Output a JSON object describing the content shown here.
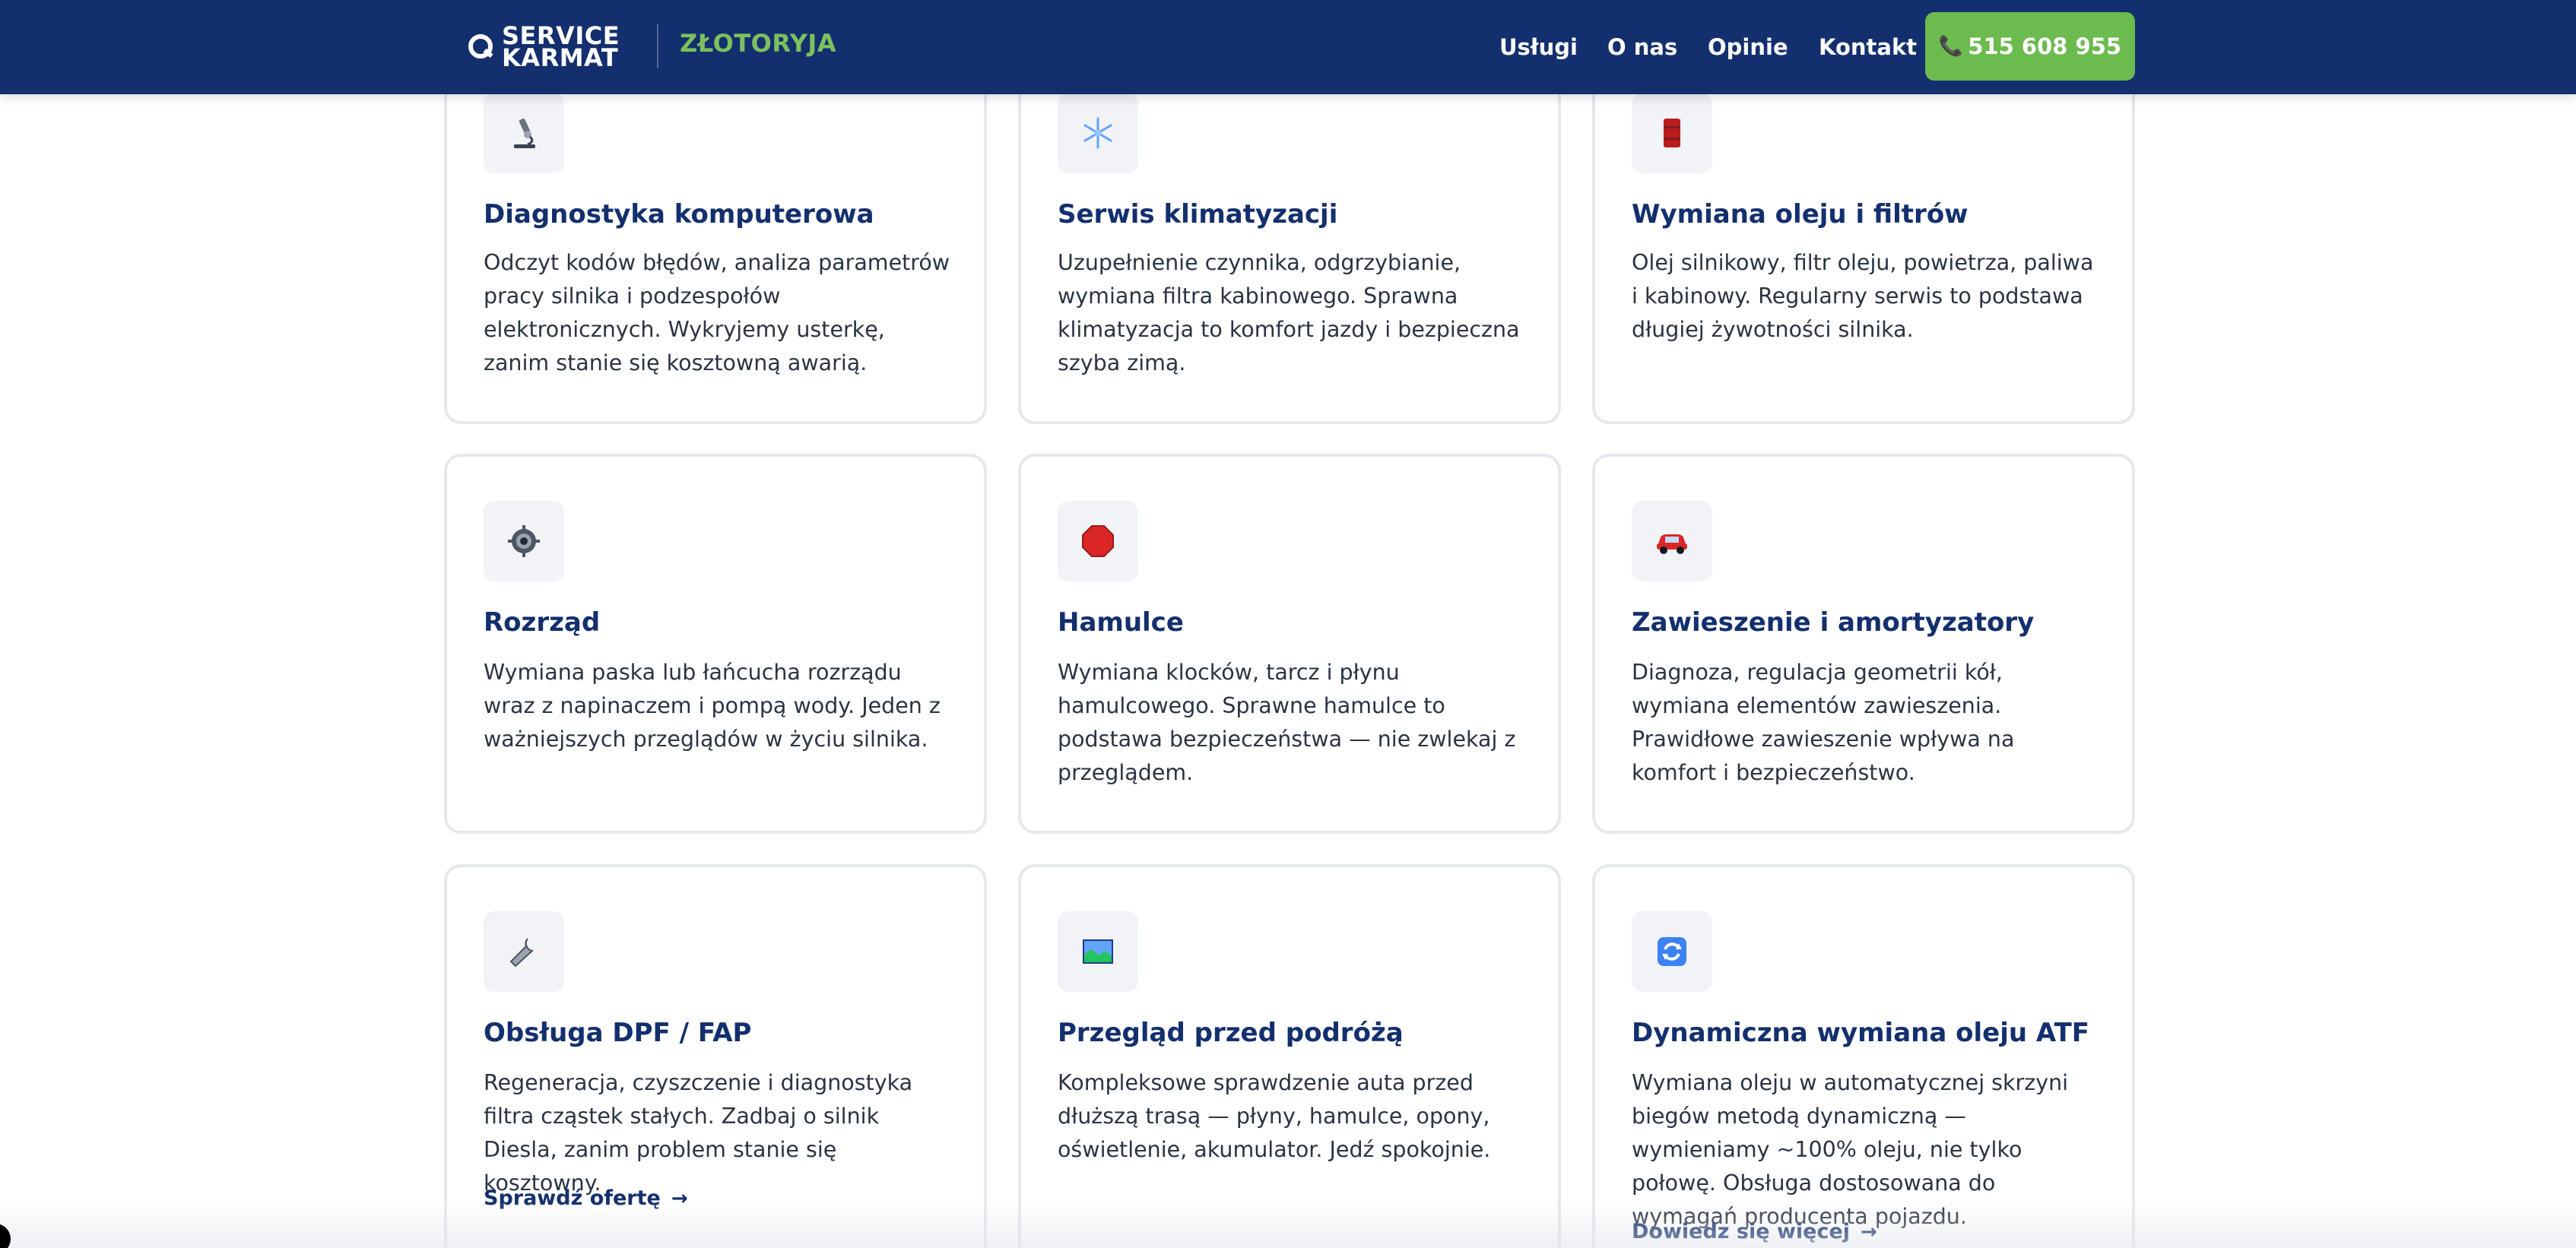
{
  "header": {
    "logo_line1": "SERVICE",
    "logo_line2": "KARMAT",
    "city": "ZŁOTORYJA",
    "nav": {
      "uslugi": "Usługi",
      "onas": "O nas",
      "opinie": "Opinie",
      "kontakt": "Kontakt"
    },
    "phone": "515 608 955"
  },
  "colors": {
    "brand_navy": "#132f6e",
    "brand_green": "#6cbb4e",
    "city_green": "#7cc05e"
  },
  "services": [
    {
      "icon": "microscope-icon",
      "title": "Diagnostyka komputerowa",
      "desc": "Odczyt kodów błędów, analiza parametrów pracy silnika i podzespołów elektronicznych. Wykryjemy usterkę, zanim stanie się kosztowną awarią."
    },
    {
      "icon": "snowflake-icon",
      "title": "Serwis klimatyzacji",
      "desc": "Uzupełnienie czynnika, odgrzybianie, wymiana filtra kabinowego. Sprawna klimatyzacja to komfort jazdy i bezpieczna szyba zimą."
    },
    {
      "icon": "oil-drum-icon",
      "title": "Wymiana oleju i filtrów",
      "desc": "Olej silnikowy, filtr oleju, powietrza, paliwa i kabinowy. Regularny serwis to podstawa długiej żywotności silnika."
    },
    {
      "icon": "gear-icon",
      "title": "Rozrząd",
      "desc": "Wymiana paska lub łańcucha rozrządu wraz z napinaczem i pompą wody. Jeden z ważniejszych przeglądów w życiu silnika."
    },
    {
      "icon": "stop-sign-icon",
      "title": "Hamulce",
      "desc": "Wymiana klocków, tarcz i płynu hamulcowego. Sprawne hamulce to podstawa bezpieczeństwa — nie zwlekaj z przeglądem."
    },
    {
      "icon": "car-icon",
      "title": "Zawieszenie i amortyzatory",
      "desc": "Diagnoza, regulacja geometrii kół, wymiana elementów zawieszenia. Prawidłowe zawieszenie wpływa na komfort i bezpieczeństwo."
    },
    {
      "icon": "wrench-icon",
      "title": "Obsługa DPF / FAP",
      "desc": "Regeneracja, czyszczenie i diagnostyka filtra cząstek stałych. Zadbaj o silnik Diesla, zanim problem stanie się kosztowny.",
      "link": "Sprawdź ofertę"
    },
    {
      "icon": "map-icon",
      "title": "Przegląd przed podróżą",
      "desc": "Kompleksowe sprawdzenie auta przed dłuższą trasą — płyny, hamulce, opony, oświetlenie, akumulator. Jedź spokojnie."
    },
    {
      "icon": "refresh-icon",
      "title": "Dynamiczna wymiana oleju ATF",
      "desc": "Wymiana oleju w automatycznej skrzyni biegów metodą dynamiczną — wymieniamy ~100% oleju, nie tylko połowę. Obsługa dostosowana do wymagań producenta pojazdu.",
      "link": "Dowiedz się więcej"
    }
  ]
}
